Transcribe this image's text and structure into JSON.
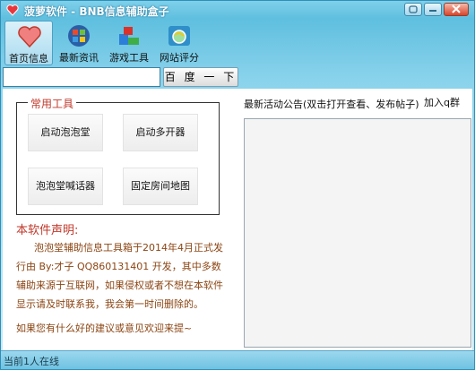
{
  "window": {
    "title": "菠萝软件 - BNB信息辅助盒子"
  },
  "toolbar": {
    "items": [
      {
        "label": "首页信息",
        "icon": "heart-icon",
        "active": true
      },
      {
        "label": "最新资讯",
        "icon": "windows-logo-icon",
        "active": false
      },
      {
        "label": "游戏工具",
        "icon": "blocks-icon",
        "active": false
      },
      {
        "label": "网站评分",
        "icon": "browser-icon",
        "active": false
      }
    ]
  },
  "search": {
    "value": "",
    "button_label": "百 度 一 下"
  },
  "tools_group": {
    "title": "常用工具",
    "buttons": [
      "启动泡泡堂",
      "启动多开器",
      "泡泡堂喊话器",
      "固定房间地图"
    ]
  },
  "declaration": {
    "title": "本软件声明:",
    "paragraph1": "泡泡堂辅助信息工具箱于2014年4月正式发行由 By:才子 QQ860131401 开发，其中多数辅助来源于互联网，如果侵权或者不想在本软件显示请及时联系我，我会第一时间删除的。",
    "paragraph2": "如果您有什么好的建议或意见欢迎来提~"
  },
  "notice": {
    "label": "最新活动公告(双击打开查看、发布帖子)",
    "join_label": "加入q群"
  },
  "status": {
    "text": "当前1人在线"
  },
  "colors": {
    "accent_red": "#c0392b",
    "declaration_text": "#8b4513",
    "frame_blue": "#5fbfdf"
  }
}
